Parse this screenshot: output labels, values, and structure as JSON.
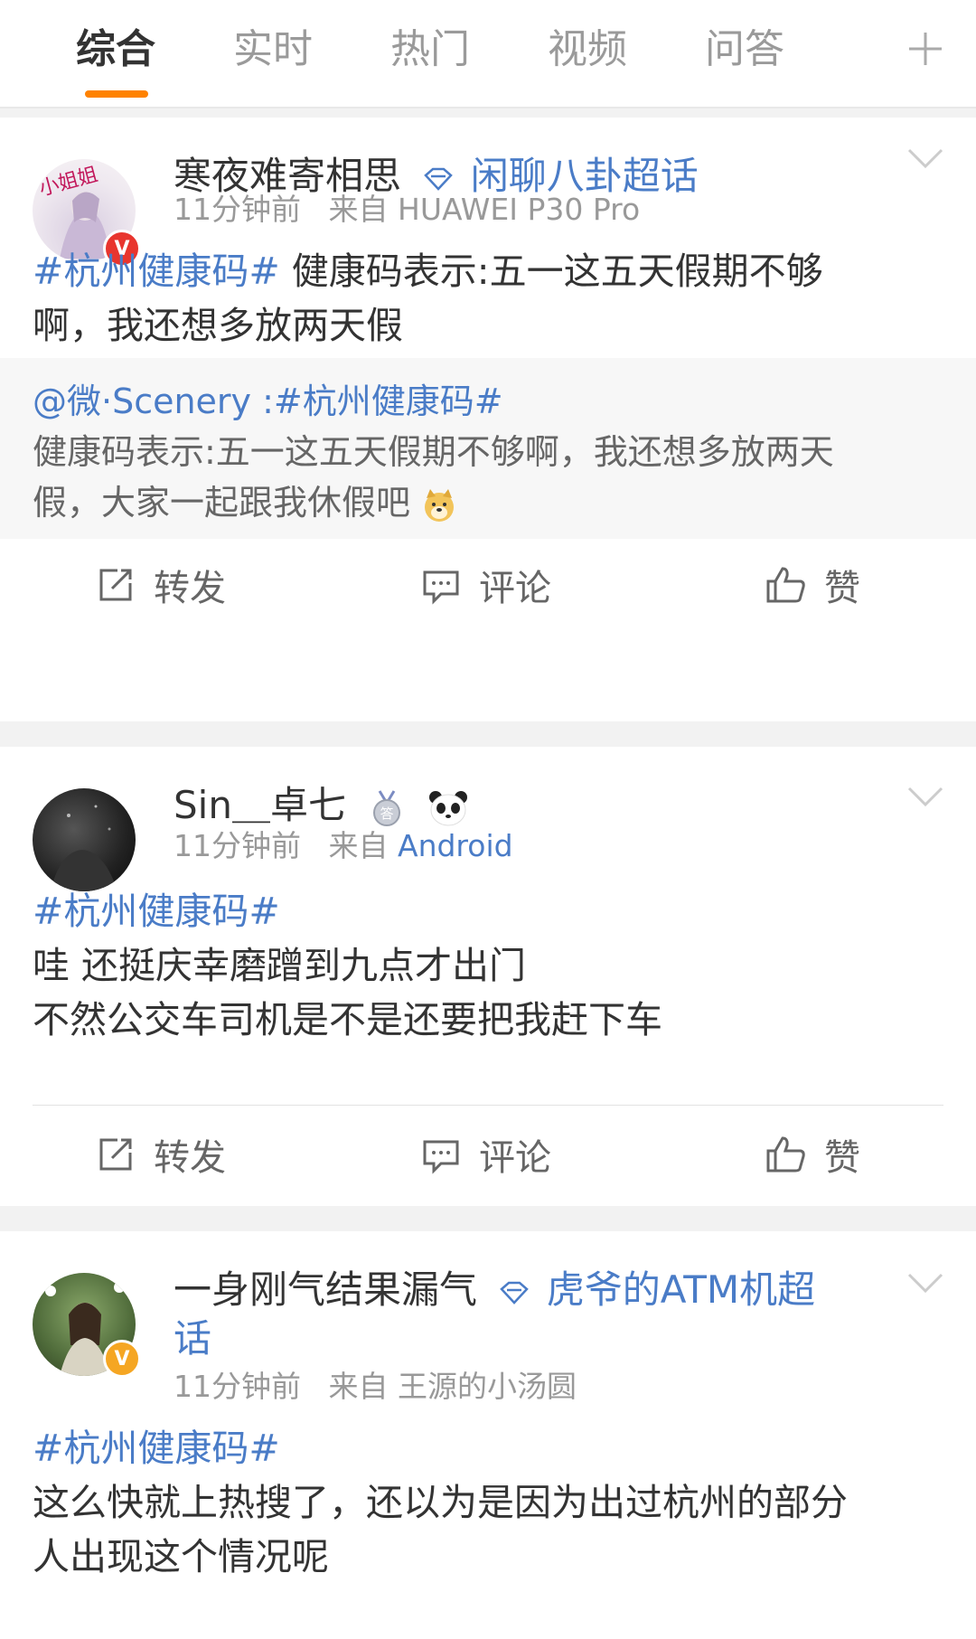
{
  "tabs": [
    {
      "label": "综合"
    },
    {
      "label": "实时"
    },
    {
      "label": "热门"
    },
    {
      "label": "视频"
    },
    {
      "label": "问答"
    }
  ],
  "posts": [
    {
      "user": "寒夜难寄相思",
      "topic": "闲聊八卦超话",
      "time": "11分钟前",
      "source_prefix": "来自",
      "source": "HUAWEI P30 Pro",
      "hashtag": "#杭州健康码#",
      "text_line1": "健康码表示:五一这五天假期不够",
      "text_line2": "啊，我还想多放两天假",
      "quote": {
        "mention": "@微·Scenery :#杭州健康码#",
        "line1": "健康码表示:五一这五天假期不够啊，我还想多放两天",
        "line2": "假，大家一起跟我休假吧"
      },
      "avatar_text": "小姐姐"
    },
    {
      "user": "Sin＿卓七",
      "time": "11分钟前",
      "source_prefix": "来自",
      "source": "Android",
      "hashtag": "#杭州健康码#",
      "text_line1": "哇 还挺庆幸磨蹭到九点才出门",
      "text_line2": "不然公交车司机是不是还要把我赶下车"
    },
    {
      "user": "一身刚气结果漏气",
      "topic_line1": "虎爷的ATM机超",
      "topic_line2": "话",
      "time": "11分钟前",
      "source_prefix": "来自",
      "source": "王源的小汤圆",
      "hashtag": "#杭州健康码#",
      "text_line1": "这么快就上热搜了，还以为是因为出过杭州的部分",
      "text_line2": "人出现这个情况呢"
    }
  ],
  "actions": {
    "repost": "转发",
    "comment": "评论",
    "like": "赞"
  },
  "colors": {
    "accent": "#ff8200",
    "link": "#4a7cc7",
    "verified_red": "#e8352e",
    "verified_gold": "#f5a623"
  }
}
